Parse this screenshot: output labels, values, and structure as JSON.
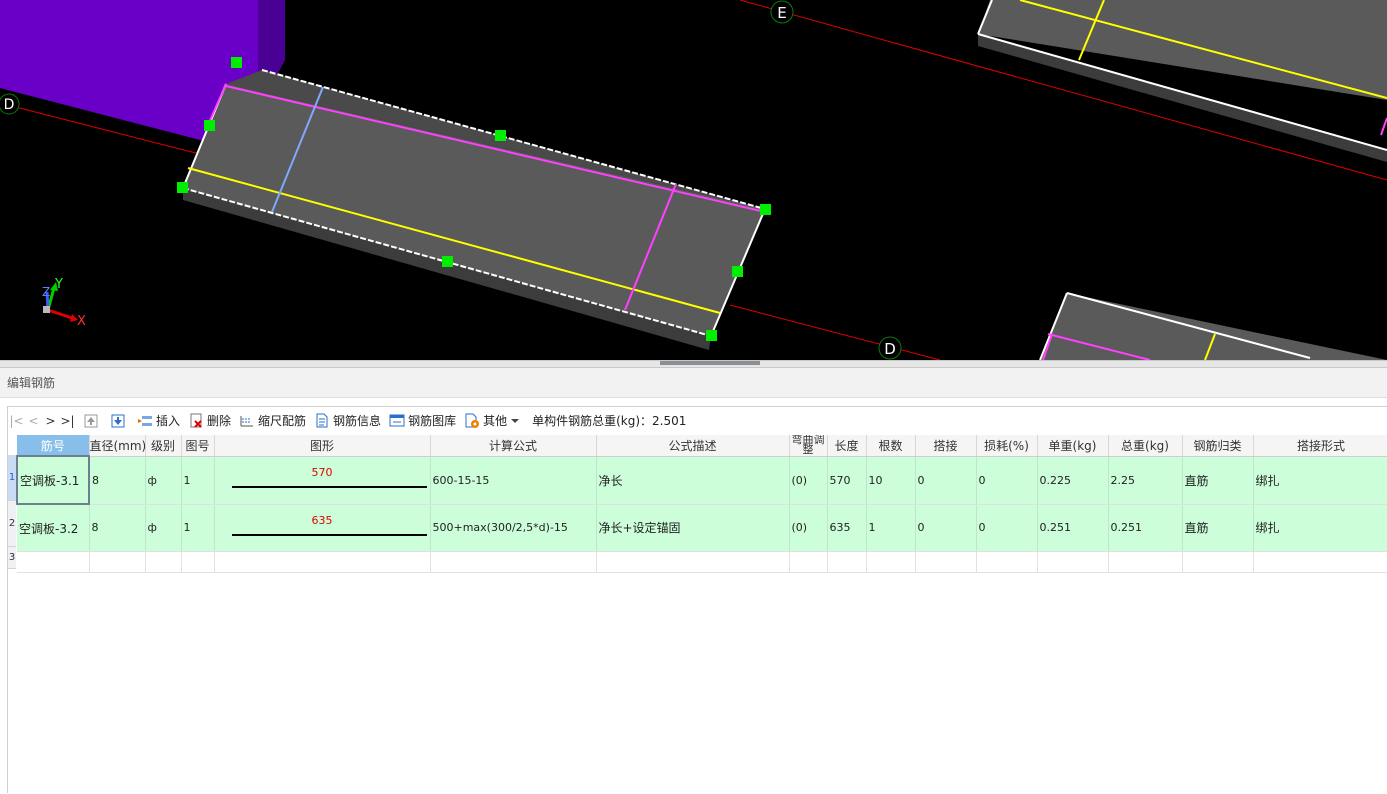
{
  "viewport": {
    "axis_labels": [
      "D",
      "E",
      "D"
    ],
    "axis": {
      "x": "X",
      "y": "Y",
      "z": "Z"
    },
    "colors": {
      "background": "#000000",
      "slab": "#5a5a5a",
      "column": "#6a00c8",
      "grip": "#00ee00",
      "magenta": "#ff40ff",
      "yellow": "#ffff00",
      "blue": "#7fa8ff",
      "red": "#e00000"
    }
  },
  "panel": {
    "title": "编辑钢筋",
    "toolbar": {
      "nav_first": "|<",
      "nav_prev": "<",
      "nav_next": ">",
      "nav_last": ">|",
      "insert": "插入",
      "delete": "删除",
      "scale_rebar": "缩尺配筋",
      "rebar_info": "钢筋信息",
      "rebar_library": "钢筋图库",
      "other": "其他",
      "total_weight": "单构件钢筋总重(kg)：2.501"
    },
    "columns": [
      "筋号",
      "直径(mm)",
      "级别",
      "图号",
      "图形",
      "计算公式",
      "公式描述",
      "弯曲调整",
      "长度",
      "根数",
      "搭接",
      "损耗(%)",
      "单重(kg)",
      "总重(kg)",
      "钢筋归类",
      "搭接形式"
    ],
    "row_numbers": [
      "1",
      "2",
      "3"
    ],
    "rows": [
      {
        "name": "空调板-3.1",
        "diameter": "8",
        "grade": "ф",
        "shape_no": "1",
        "shape_value": "570",
        "formula": "600-15-15",
        "description": "净长",
        "bend": "(0)",
        "length": "570",
        "count": "10",
        "lap": "0",
        "loss": "0",
        "unit_weight": "0.225",
        "total_weight": "2.25",
        "category": "直筋",
        "lap_type": "绑扎"
      },
      {
        "name": "空调板-3.2",
        "diameter": "8",
        "grade": "ф",
        "shape_no": "1",
        "shape_value": "635",
        "formula": "500+max(300/2,5*d)-15",
        "description": "净长+设定锚固",
        "bend": "(0)",
        "length": "635",
        "count": "1",
        "lap": "0",
        "loss": "0",
        "unit_weight": "0.251",
        "total_weight": "0.251",
        "category": "直筋",
        "lap_type": "绑扎"
      }
    ]
  }
}
